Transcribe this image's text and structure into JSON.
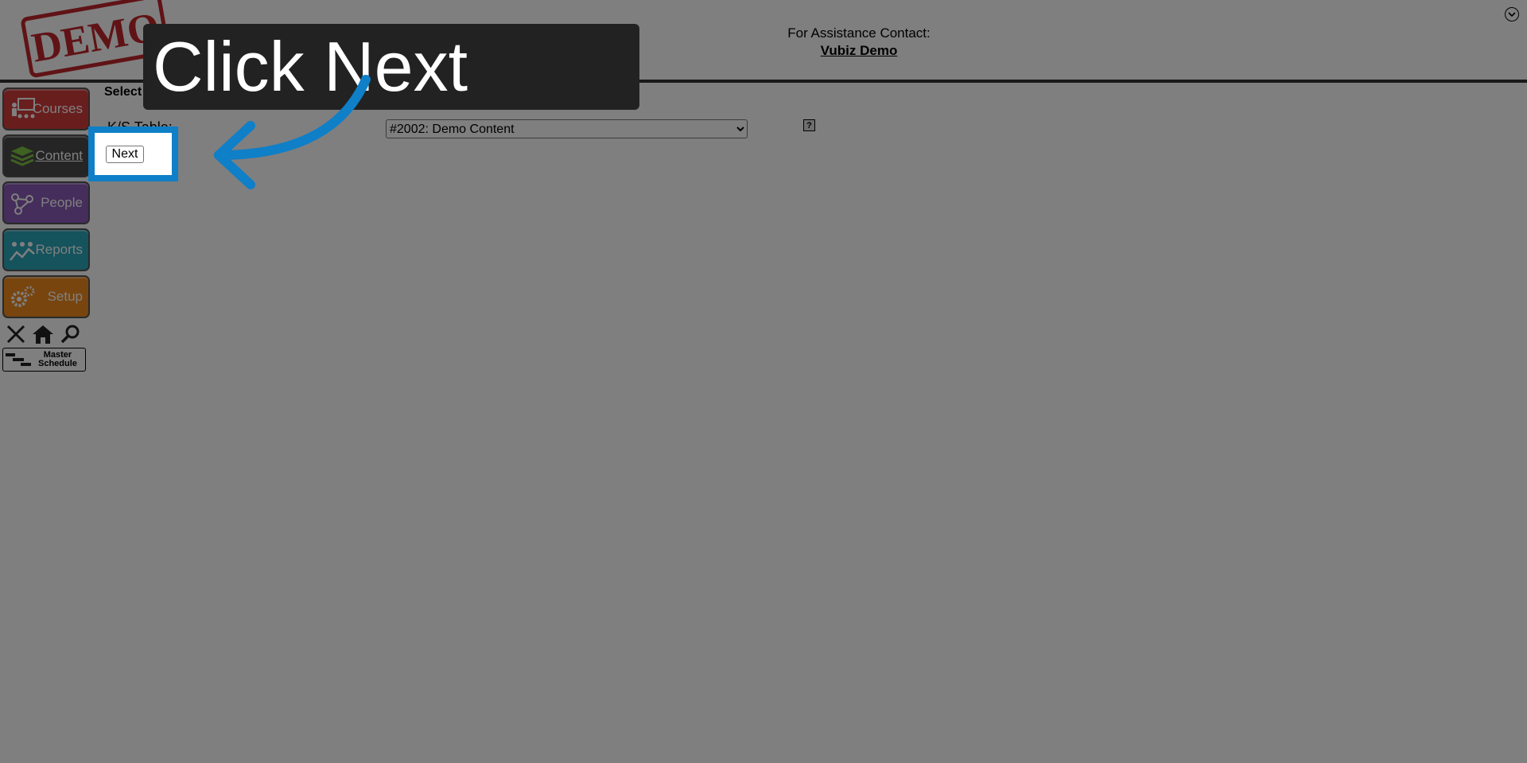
{
  "stamp": {
    "text": "DEMO",
    "color": "#c0272d"
  },
  "header": {
    "assistance_label": "For Assistance Contact:",
    "assistance_link": "Vubiz Demo",
    "collapse_icon": "chevron-down-icon"
  },
  "sidebar": {
    "items": [
      {
        "label": "Courses",
        "color": "#d23c3c",
        "icon": "teacher-icon"
      },
      {
        "label": "Content",
        "color": "#4a4a4a",
        "icon": "stack-icon",
        "active": true
      },
      {
        "label": "People",
        "color": "#8a5bb8",
        "icon": "network-icon"
      },
      {
        "label": "Reports",
        "color": "#2aa6bb",
        "icon": "chart-people-icon"
      },
      {
        "label": "Setup",
        "color": "#f08a1e",
        "icon": "gears-icon"
      }
    ],
    "tools": [
      "close-icon",
      "home-icon",
      "search-icon"
    ],
    "master_schedule": {
      "line1": "Master",
      "line2": "Schedule",
      "icon": "gantt-icon"
    }
  },
  "main": {
    "section_title": "Select A K/S Table",
    "ks_label": "K/S Table:",
    "ks_select_value": "#2002: Demo Content",
    "help_glyph": "?",
    "next_label": "Next"
  },
  "overlay": {
    "tooltip": "Click Next",
    "accent": "#0f7fc8",
    "dim_color": "rgba(0,0,0,0.5)"
  }
}
